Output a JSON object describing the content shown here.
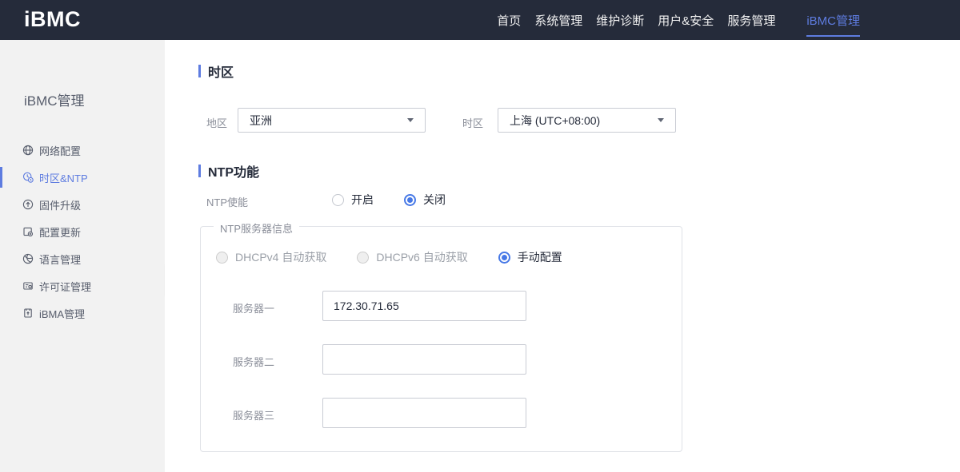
{
  "header": {
    "logo": "iBMC",
    "nav": [
      {
        "label": "首页",
        "active": false
      },
      {
        "label": "系统管理",
        "active": false
      },
      {
        "label": "维护诊断",
        "active": false
      },
      {
        "label": "用户&安全",
        "active": false
      },
      {
        "label": "服务管理",
        "active": false
      },
      {
        "label": "iBMC管理",
        "active": true
      }
    ]
  },
  "sidebar": {
    "title": "iBMC管理",
    "items": [
      {
        "label": "网络配置",
        "icon": "network-globe-icon",
        "active": false
      },
      {
        "label": "时区&NTP",
        "icon": "timezone-clock-icon",
        "active": true
      },
      {
        "label": "固件升级",
        "icon": "firmware-upgrade-icon",
        "active": false
      },
      {
        "label": "配置更新",
        "icon": "config-update-icon",
        "active": false
      },
      {
        "label": "语言管理",
        "icon": "language-icon",
        "active": false
      },
      {
        "label": "许可证管理",
        "icon": "license-icon",
        "active": false
      },
      {
        "label": "iBMA管理",
        "icon": "ibma-icon",
        "active": false
      }
    ],
    "collapse_icon": "chevron-left-icon"
  },
  "main": {
    "timezone_section": {
      "title": "时区",
      "region_label": "地区",
      "region_value": "亚洲",
      "timezone_label": "时区",
      "timezone_value": "上海 (UTC+08:00)"
    },
    "ntp_section": {
      "title": "NTP功能",
      "enable_label": "NTP使能",
      "enable_options": [
        {
          "label": "开启",
          "selected": false
        },
        {
          "label": "关闭",
          "selected": true
        }
      ],
      "server_group": {
        "legend": "NTP服务器信息",
        "mode_options": [
          {
            "label": "DHCPv4 自动获取",
            "selected": false,
            "disabled": true
          },
          {
            "label": "DHCPv6 自动获取",
            "selected": false,
            "disabled": true
          },
          {
            "label": "手动配置",
            "selected": true,
            "disabled": false
          }
        ],
        "servers": [
          {
            "label": "服务器一",
            "value": "172.30.71.65"
          },
          {
            "label": "服务器二",
            "value": ""
          },
          {
            "label": "服务器三",
            "value": ""
          }
        ]
      }
    }
  },
  "colors": {
    "header_bg": "#252b3a",
    "sidebar_bg": "#f2f2f2",
    "accent": "#5e7ce0",
    "radio_selected": "#4678e6",
    "label_gray": "#8a8e99",
    "title_dark": "#252b3a"
  }
}
